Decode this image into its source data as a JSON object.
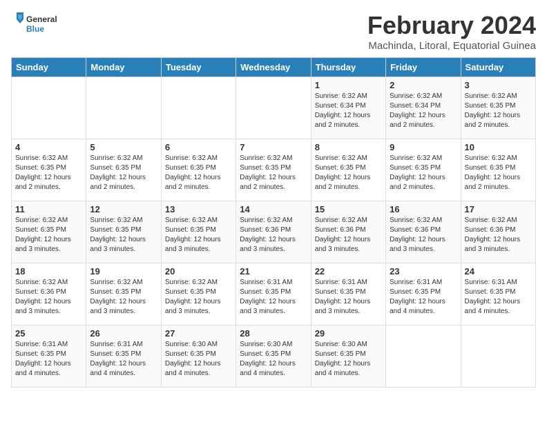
{
  "logo": {
    "general": "General",
    "blue": "Blue"
  },
  "title": "February 2024",
  "subtitle": "Machinda, Litoral, Equatorial Guinea",
  "days_of_week": [
    "Sunday",
    "Monday",
    "Tuesday",
    "Wednesday",
    "Thursday",
    "Friday",
    "Saturday"
  ],
  "weeks": [
    [
      {
        "day": "",
        "info": ""
      },
      {
        "day": "",
        "info": ""
      },
      {
        "day": "",
        "info": ""
      },
      {
        "day": "",
        "info": ""
      },
      {
        "day": "1",
        "info": "Sunrise: 6:32 AM\nSunset: 6:34 PM\nDaylight: 12 hours\nand 2 minutes."
      },
      {
        "day": "2",
        "info": "Sunrise: 6:32 AM\nSunset: 6:34 PM\nDaylight: 12 hours\nand 2 minutes."
      },
      {
        "day": "3",
        "info": "Sunrise: 6:32 AM\nSunset: 6:35 PM\nDaylight: 12 hours\nand 2 minutes."
      }
    ],
    [
      {
        "day": "4",
        "info": "Sunrise: 6:32 AM\nSunset: 6:35 PM\nDaylight: 12 hours\nand 2 minutes."
      },
      {
        "day": "5",
        "info": "Sunrise: 6:32 AM\nSunset: 6:35 PM\nDaylight: 12 hours\nand 2 minutes."
      },
      {
        "day": "6",
        "info": "Sunrise: 6:32 AM\nSunset: 6:35 PM\nDaylight: 12 hours\nand 2 minutes."
      },
      {
        "day": "7",
        "info": "Sunrise: 6:32 AM\nSunset: 6:35 PM\nDaylight: 12 hours\nand 2 minutes."
      },
      {
        "day": "8",
        "info": "Sunrise: 6:32 AM\nSunset: 6:35 PM\nDaylight: 12 hours\nand 2 minutes."
      },
      {
        "day": "9",
        "info": "Sunrise: 6:32 AM\nSunset: 6:35 PM\nDaylight: 12 hours\nand 2 minutes."
      },
      {
        "day": "10",
        "info": "Sunrise: 6:32 AM\nSunset: 6:35 PM\nDaylight: 12 hours\nand 2 minutes."
      }
    ],
    [
      {
        "day": "11",
        "info": "Sunrise: 6:32 AM\nSunset: 6:35 PM\nDaylight: 12 hours\nand 3 minutes."
      },
      {
        "day": "12",
        "info": "Sunrise: 6:32 AM\nSunset: 6:35 PM\nDaylight: 12 hours\nand 3 minutes."
      },
      {
        "day": "13",
        "info": "Sunrise: 6:32 AM\nSunset: 6:35 PM\nDaylight: 12 hours\nand 3 minutes."
      },
      {
        "day": "14",
        "info": "Sunrise: 6:32 AM\nSunset: 6:36 PM\nDaylight: 12 hours\nand 3 minutes."
      },
      {
        "day": "15",
        "info": "Sunrise: 6:32 AM\nSunset: 6:36 PM\nDaylight: 12 hours\nand 3 minutes."
      },
      {
        "day": "16",
        "info": "Sunrise: 6:32 AM\nSunset: 6:36 PM\nDaylight: 12 hours\nand 3 minutes."
      },
      {
        "day": "17",
        "info": "Sunrise: 6:32 AM\nSunset: 6:36 PM\nDaylight: 12 hours\nand 3 minutes."
      }
    ],
    [
      {
        "day": "18",
        "info": "Sunrise: 6:32 AM\nSunset: 6:36 PM\nDaylight: 12 hours\nand 3 minutes."
      },
      {
        "day": "19",
        "info": "Sunrise: 6:32 AM\nSunset: 6:35 PM\nDaylight: 12 hours\nand 3 minutes."
      },
      {
        "day": "20",
        "info": "Sunrise: 6:32 AM\nSunset: 6:35 PM\nDaylight: 12 hours\nand 3 minutes."
      },
      {
        "day": "21",
        "info": "Sunrise: 6:31 AM\nSunset: 6:35 PM\nDaylight: 12 hours\nand 3 minutes."
      },
      {
        "day": "22",
        "info": "Sunrise: 6:31 AM\nSunset: 6:35 PM\nDaylight: 12 hours\nand 3 minutes."
      },
      {
        "day": "23",
        "info": "Sunrise: 6:31 AM\nSunset: 6:35 PM\nDaylight: 12 hours\nand 4 minutes."
      },
      {
        "day": "24",
        "info": "Sunrise: 6:31 AM\nSunset: 6:35 PM\nDaylight: 12 hours\nand 4 minutes."
      }
    ],
    [
      {
        "day": "25",
        "info": "Sunrise: 6:31 AM\nSunset: 6:35 PM\nDaylight: 12 hours\nand 4 minutes."
      },
      {
        "day": "26",
        "info": "Sunrise: 6:31 AM\nSunset: 6:35 PM\nDaylight: 12 hours\nand 4 minutes."
      },
      {
        "day": "27",
        "info": "Sunrise: 6:30 AM\nSunset: 6:35 PM\nDaylight: 12 hours\nand 4 minutes."
      },
      {
        "day": "28",
        "info": "Sunrise: 6:30 AM\nSunset: 6:35 PM\nDaylight: 12 hours\nand 4 minutes."
      },
      {
        "day": "29",
        "info": "Sunrise: 6:30 AM\nSunset: 6:35 PM\nDaylight: 12 hours\nand 4 minutes."
      },
      {
        "day": "",
        "info": ""
      },
      {
        "day": "",
        "info": ""
      }
    ]
  ]
}
